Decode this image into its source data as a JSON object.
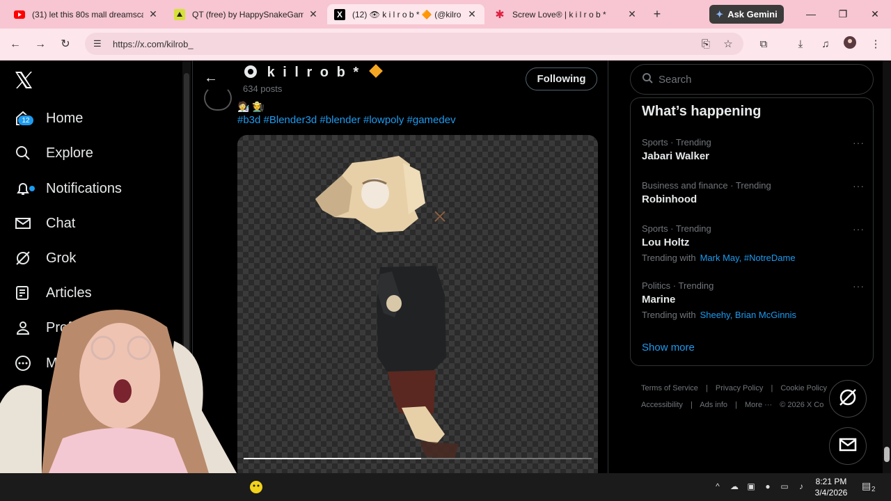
{
  "browser": {
    "tabs": [
      {
        "title": "(31) let this 80s mall dreamsca",
        "favicon": "youtube-icon",
        "active": false
      },
      {
        "title": "QT (free) by HappySnakeGam",
        "favicon": "itch-icon",
        "active": false
      },
      {
        "title": "(12) 👁 k i l r o b * 🔶 (@kilro",
        "favicon": "x-icon",
        "active": true
      },
      {
        "title": "Screw Love® | k i l r o b *",
        "favicon": "star-icon",
        "active": false
      }
    ],
    "gemini_label": "Ask Gemini",
    "url": "https://x.com/kilrob_"
  },
  "nav": {
    "items": [
      {
        "label": "Home",
        "icon": "home-icon"
      },
      {
        "label": "Explore",
        "icon": "search-icon"
      },
      {
        "label": "Notifications",
        "icon": "bell-icon"
      },
      {
        "label": "Chat",
        "icon": "mail-icon"
      },
      {
        "label": "Grok",
        "icon": "grok-icon"
      },
      {
        "label": "Articles",
        "icon": "article-icon"
      },
      {
        "label": "Profile",
        "icon": "person-icon"
      },
      {
        "label": "More",
        "icon": "more-icon"
      }
    ],
    "notif_count": "12"
  },
  "profile": {
    "name": "k i l r o b *",
    "posts": "634 posts",
    "follow_label": "Following"
  },
  "post": {
    "emojis": "🧑‍🔬 🧑‍🌾",
    "hashtags": "#b3d #Blender3d #blender #lowpoly #gamedev",
    "video_progress": 0.51
  },
  "search": {
    "placeholder": "Search"
  },
  "trends": {
    "title": "What’s happening",
    "items": [
      {
        "meta": "Sports · Trending",
        "name": "Jabari Walker",
        "with": "",
        "links": ""
      },
      {
        "meta": "Business and finance · Trending",
        "name": "Robinhood",
        "with": "",
        "links": ""
      },
      {
        "meta": "Sports · Trending",
        "name": "Lou Holtz",
        "with": "Trending with",
        "links": "Mark May, #NotreDame"
      },
      {
        "meta": "Politics · Trending",
        "name": "Marine",
        "with": "Trending with",
        "links": "Sheehy, Brian McGinnis"
      }
    ],
    "show_more": "Show more"
  },
  "footer": {
    "links": [
      "Terms of Service",
      "|",
      "Privacy Policy",
      "|",
      "Cookie Policy",
      "Accessibility",
      "|",
      "Ads info",
      "|",
      "More ···",
      "© 2026 X Co"
    ]
  },
  "taskbar": {
    "time": "8:21 PM",
    "date": "3/4/2026",
    "notif": "2"
  }
}
